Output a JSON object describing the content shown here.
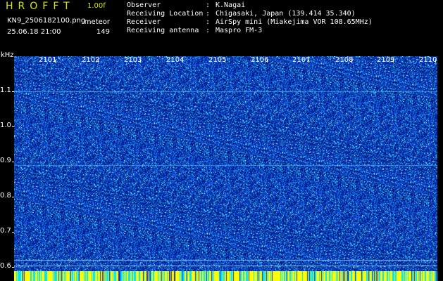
{
  "header": {
    "app_title": "HROFFT",
    "version": "1.00f",
    "file_name": "KN9_2506182100.png",
    "datetime": "25.06.18 21:00",
    "meteor_label": "meteor",
    "meteor_count": "149"
  },
  "info": [
    {
      "label": "Observer",
      "sep": ":",
      "value": "K.Nagai"
    },
    {
      "label": "Receiving Location",
      "sep": ":",
      "value": "Chigasaki, Japan (139.414 35.340)"
    },
    {
      "label": "Receiver",
      "sep": ":",
      "value": "AirSpy mini (Miakejima VOR 108.65MHz)"
    },
    {
      "label": "Receiving antenna",
      "sep": ":",
      "value": "Maspro FM-3"
    }
  ],
  "axes": {
    "y_unit": "kHz",
    "y_ticks": [
      "1.1",
      "1.0",
      "0.9",
      "0.8",
      "0.7",
      "0.6"
    ],
    "x_ticks": [
      "2101",
      "2102",
      "2103",
      "2104",
      "2105",
      "2106",
      "2107",
      "2108",
      "2109",
      "2110"
    ]
  },
  "colors": {
    "title": "#d6e41a",
    "background": "#000000",
    "noise_base": "#0a1a8c",
    "strip_yellow": "#ffff00",
    "strip_cyan": "#00e5ff"
  }
}
